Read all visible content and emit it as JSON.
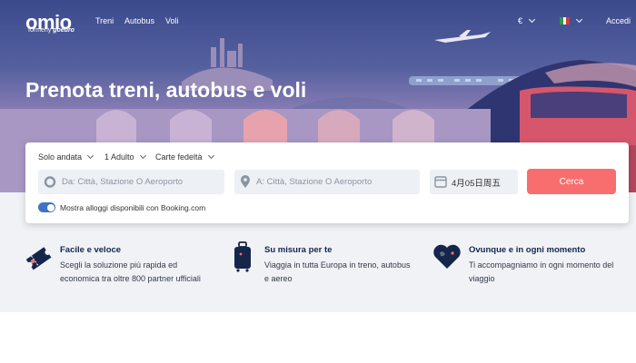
{
  "header": {
    "logo_text": "omio",
    "logo_sub_prefix": "formerly",
    "logo_sub_brand": "goeuro",
    "nav": [
      "Treni",
      "Autobus",
      "Voli"
    ],
    "currency": "€",
    "language_flag": "Italian flag",
    "login_label": "Accedi"
  },
  "hero": {
    "title": "Prenota treni, autobus e voli"
  },
  "search": {
    "trip_type": "Solo andata",
    "passengers": "1 Adulto",
    "loyalty_cards": "Carte fedeltà",
    "from_placeholder": "Da: Città, Stazione O Aeroporto",
    "to_placeholder": "A: Città, Stazione O Aeroporto",
    "date": "4月05日周五",
    "search_button": "Cerca",
    "booking_toggle_label": "Mostra alloggi disponibili con Booking.com",
    "booking_toggle_on": true
  },
  "features": [
    {
      "icon": "ticket-icon",
      "title": "Facile e veloce",
      "desc_1": "Scegli la soluzione più rapida ed",
      "desc_2": "economica tra oltre 800 partner ufficiali"
    },
    {
      "icon": "suitcase-icon",
      "title": "Su misura per te",
      "desc_1": "Viaggia in tutta Europa in treno, autobus",
      "desc_2": "e aereo"
    },
    {
      "icon": "heart-globe-icon",
      "title": "Ovunque e in ogni momento",
      "desc_1": "Ti accompagniamo in ogni momento del",
      "desc_2": "viaggio"
    }
  ],
  "colors": {
    "accent": "#f86e6e",
    "navy": "#14264a",
    "toggle": "#3e73c4",
    "hero_top": "#3b4a8c"
  }
}
